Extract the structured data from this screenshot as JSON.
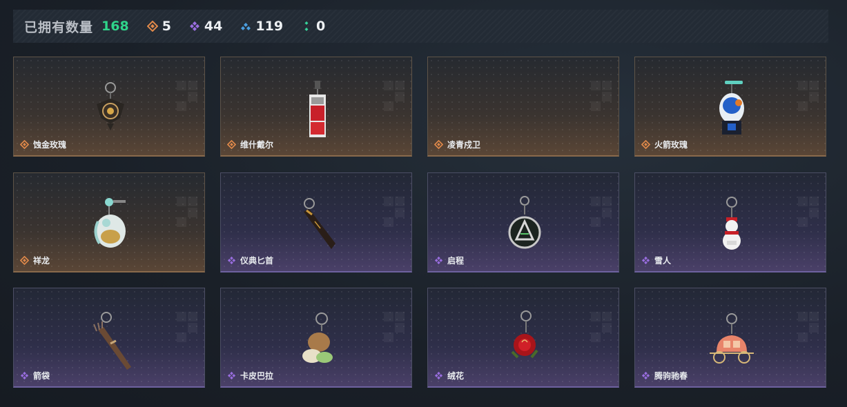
{
  "header": {
    "owned_label": "已拥有数量",
    "owned_count": "168",
    "stats": [
      {
        "icon": "orange-diamond-icon",
        "value": "5",
        "color": "#e0894a"
      },
      {
        "icon": "purple-diamond-icon",
        "value": "44",
        "color": "#9a6ee0"
      },
      {
        "icon": "blue-diamond-icon",
        "value": "119",
        "color": "#4a9ee0"
      },
      {
        "icon": "green-diamond-icon",
        "value": "0",
        "color": "#36d39a"
      }
    ]
  },
  "items": [
    {
      "name": "蚀金玫瑰",
      "rarity": "orange",
      "icon": "rose-keychain-icon"
    },
    {
      "name": "维什戴尔",
      "rarity": "orange",
      "icon": "card-keychain-icon"
    },
    {
      "name": "凌青戍卫",
      "rarity": "orange",
      "icon": "empty-keychain-icon"
    },
    {
      "name": "火箭玫瑰",
      "rarity": "orange",
      "icon": "rocket-keychain-icon"
    },
    {
      "name": "祥龙",
      "rarity": "orange",
      "icon": "dragon-keychain-icon"
    },
    {
      "name": "仪典匕首",
      "rarity": "purple",
      "icon": "dagger-keychain-icon"
    },
    {
      "name": "启程",
      "rarity": "purple",
      "icon": "medal-keychain-icon"
    },
    {
      "name": "雪人",
      "rarity": "purple",
      "icon": "snowman-keychain-icon"
    },
    {
      "name": "箭袋",
      "rarity": "purple",
      "icon": "quiver-keychain-icon"
    },
    {
      "name": "卡皮巴拉",
      "rarity": "purple",
      "icon": "capybara-keychain-icon"
    },
    {
      "name": "绒花",
      "rarity": "purple",
      "icon": "flower-keychain-icon"
    },
    {
      "name": "腾驹驰春",
      "rarity": "purple",
      "icon": "carriage-keychain-icon"
    }
  ]
}
